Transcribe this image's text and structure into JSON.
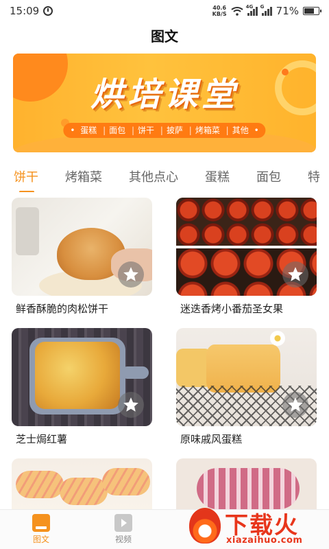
{
  "status_bar": {
    "time": "15:09",
    "net_speed_value": "40.6",
    "net_speed_unit": "KB/S",
    "signal1_tag": "4G",
    "signal2_tag": "G",
    "battery": "71%",
    "battery_level": 0.71
  },
  "header": {
    "title": "图文"
  },
  "banner": {
    "headline": "烘培课堂",
    "categories": [
      "蛋糕",
      "面包",
      "饼干",
      "披萨",
      "烤箱菜",
      "其他"
    ]
  },
  "tabs": [
    {
      "label": "饼干",
      "active": true
    },
    {
      "label": "烤箱菜",
      "active": false
    },
    {
      "label": "其他点心",
      "active": false
    },
    {
      "label": "蛋糕",
      "active": false
    },
    {
      "label": "面包",
      "active": false
    },
    {
      "label": "特",
      "active": false
    }
  ],
  "cards": [
    {
      "title": "鲜香酥脆的肉松饼干"
    },
    {
      "title": "迷迭香烤小番茄圣女果"
    },
    {
      "title": "芝士焗红薯"
    },
    {
      "title": "原味戚风蛋糕"
    },
    {
      "title": ""
    },
    {
      "title": ""
    }
  ],
  "bottom_nav": [
    {
      "label": "图文",
      "active": true
    },
    {
      "label": "视频",
      "active": false
    }
  ],
  "watermark": {
    "title": "下载火",
    "subtitle": "xiazaihuo.com"
  },
  "colors": {
    "accent": "#f5921e",
    "banner": "#ffb22e",
    "watermark": "#e8361c"
  }
}
